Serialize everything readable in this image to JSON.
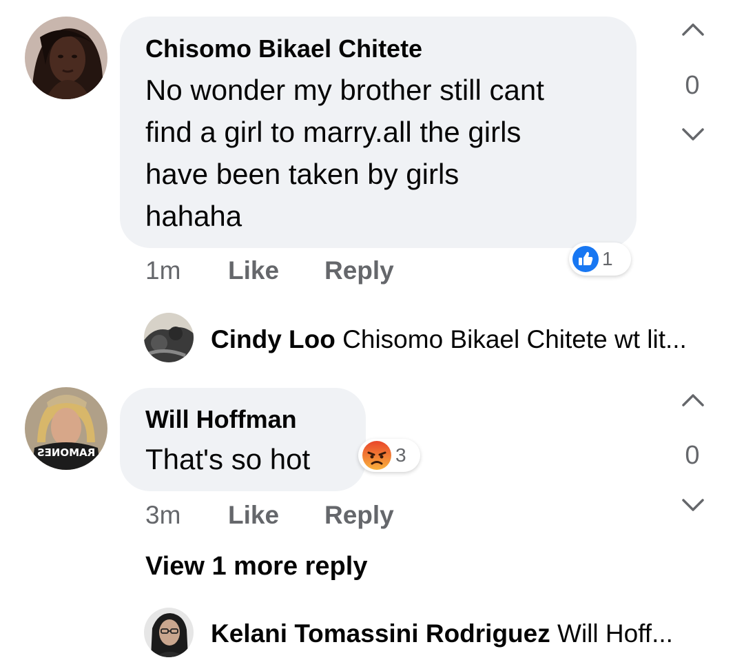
{
  "colors": {
    "bubble": "#f0f2f5",
    "like_blue": "#1877f2",
    "meta_gray": "#65676b",
    "angry_orange": "#f06a2a"
  },
  "comments": [
    {
      "author": "Chisomo Bikael Chitete",
      "lines": [
        "No wonder my brother still cant",
        "find a girl to marry.all the girls",
        "have been taken by girls",
        "hahaha"
      ],
      "time": "1m",
      "like_label": "Like",
      "reply_label": "Reply",
      "vote_count": "0",
      "reaction": {
        "icon": "thumbs-up-icon",
        "count": "1"
      },
      "reply_preview": {
        "name": "Cindy Loo",
        "text": "Chisomo Bikael Chitete wt lit..."
      }
    },
    {
      "author": "Will Hoffman",
      "lines": [
        "That's so hot"
      ],
      "time": "3m",
      "like_label": "Like",
      "reply_label": "Reply",
      "vote_count": "0",
      "reaction": {
        "icon": "angry-face-icon",
        "count": "3"
      },
      "more_replies_label": "View 1 more reply",
      "reply_preview": {
        "name": "Kelani Tomassini Rodriguez",
        "text": "Will Hoff..."
      },
      "avatar_shirt_text": "RAMONES"
    }
  ]
}
